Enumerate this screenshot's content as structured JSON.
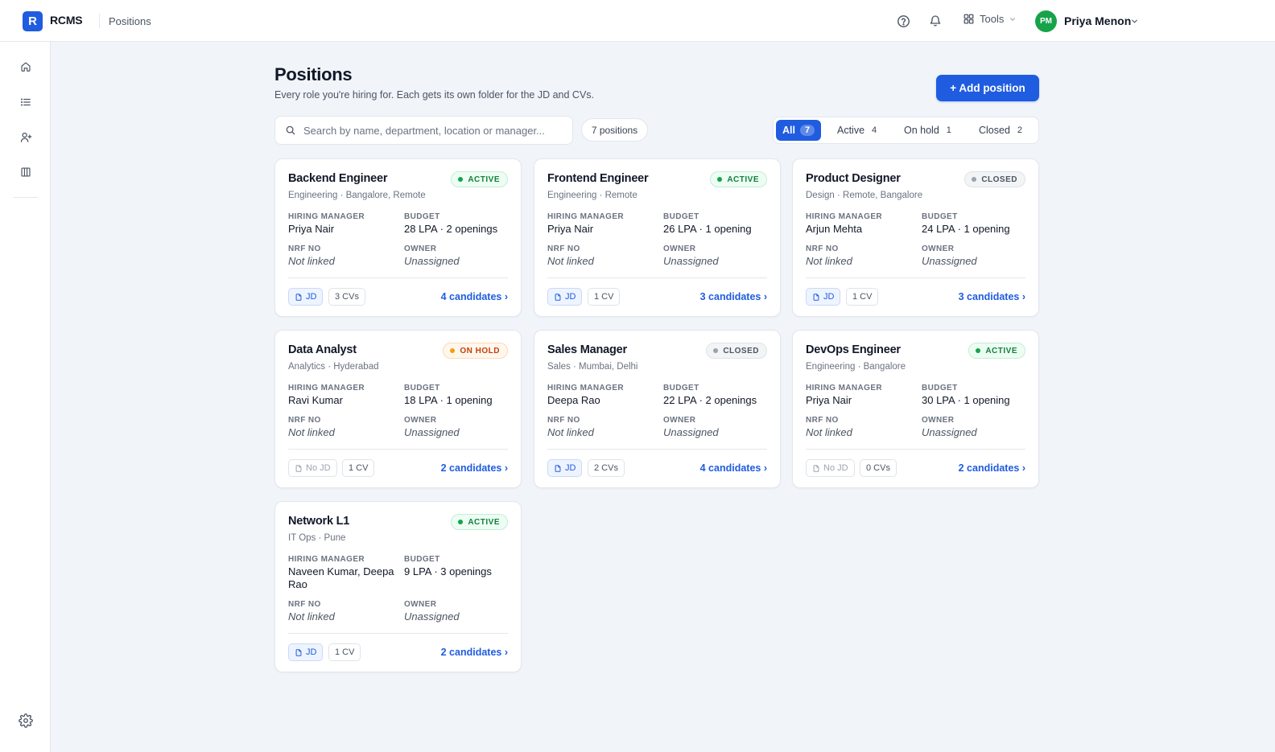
{
  "app": {
    "logo_letter": "R",
    "name": "RCMS",
    "breadcrumb": "Positions"
  },
  "topbar": {
    "tools_label": "Tools",
    "user_initials": "PM",
    "user_name": "Priya Menon"
  },
  "header": {
    "title": "Positions",
    "subtitle": "Every role you're hiring for. Each gets its own folder for the JD and CVs.",
    "add_button": "+ Add position"
  },
  "search": {
    "placeholder": "Search by name, department, location or manager...",
    "count": "7 positions"
  },
  "filters": [
    {
      "label": "All",
      "count": "7"
    },
    {
      "label": "Active",
      "count": "4"
    },
    {
      "label": "On hold",
      "count": "1"
    },
    {
      "label": "Closed",
      "count": "2"
    }
  ],
  "labels": {
    "hiring_manager": "HIRING MANAGER",
    "budget": "BUDGET",
    "nrf": "NRF NO",
    "owner": "OWNER"
  },
  "positions": [
    {
      "title": "Backend Engineer",
      "meta": "Engineering · Bangalore, Remote",
      "status": "ACTIVE",
      "manager": "Priya Nair",
      "budget": "28 LPA · 2 openings",
      "nrf": "Not linked",
      "owner": "Unassigned",
      "jd": "JD",
      "cvs": "3 CVs",
      "candidates": "4 candidates ›"
    },
    {
      "title": "Frontend Engineer",
      "meta": "Engineering · Remote",
      "status": "ACTIVE",
      "manager": "Priya Nair",
      "budget": "26 LPA · 1 opening",
      "nrf": "Not linked",
      "owner": "Unassigned",
      "jd": "JD",
      "cvs": "1 CV",
      "candidates": "3 candidates ›"
    },
    {
      "title": "Product Designer",
      "meta": "Design · Remote, Bangalore",
      "status": "CLOSED",
      "manager": "Arjun Mehta",
      "budget": "24 LPA · 1 opening",
      "nrf": "Not linked",
      "owner": "Unassigned",
      "jd": "JD",
      "cvs": "1 CV",
      "candidates": "3 candidates ›"
    },
    {
      "title": "Data Analyst",
      "meta": "Analytics · Hyderabad",
      "status": "ON HOLD",
      "manager": "Ravi Kumar",
      "budget": "18 LPA · 1 opening",
      "nrf": "Not linked",
      "owner": "Unassigned",
      "jd": "No JD",
      "cvs": "1 CV",
      "candidates": "2 candidates ›"
    },
    {
      "title": "Sales Manager",
      "meta": "Sales · Mumbai, Delhi",
      "status": "CLOSED",
      "manager": "Deepa Rao",
      "budget": "22 LPA · 2 openings",
      "nrf": "Not linked",
      "owner": "Unassigned",
      "jd": "JD",
      "cvs": "2 CVs",
      "candidates": "4 candidates ›"
    },
    {
      "title": "DevOps Engineer",
      "meta": "Engineering · Bangalore",
      "status": "ACTIVE",
      "manager": "Priya Nair",
      "budget": "30 LPA · 1 opening",
      "nrf": "Not linked",
      "owner": "Unassigned",
      "jd": "No JD",
      "cvs": "0 CVs",
      "candidates": "2 candidates ›"
    },
    {
      "title": "Network L1",
      "meta": "IT Ops · Pune",
      "status": "ACTIVE",
      "manager": "Naveen Kumar, Deepa Rao",
      "budget": "9 LPA · 3 openings",
      "nrf": "Not linked",
      "owner": "Unassigned",
      "jd": "JD",
      "cvs": "1 CV",
      "candidates": "2 candidates ›"
    }
  ],
  "icons": {
    "topbar": [
      "help-circle-icon",
      "bell-icon",
      "grid-icon",
      "chevron-down-icon"
    ],
    "sidebar": [
      "home-icon",
      "list-icon",
      "user-plus-icon",
      "columns-icon",
      "gear-icon"
    ],
    "card": [
      "file-icon"
    ]
  },
  "colors": {
    "primary": "#1f5ce0",
    "active": "#15803d",
    "hold": "#c2410c",
    "closed": "#4b5563",
    "avatar": "#16a34a"
  }
}
